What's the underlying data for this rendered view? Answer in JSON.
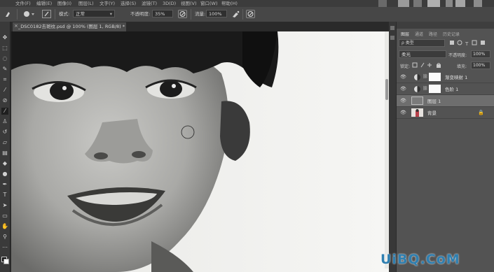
{
  "menubar": {
    "items": [
      "文件(F)",
      "编辑(E)",
      "图像(I)",
      "图层(L)",
      "文字(Y)",
      "选择(S)",
      "滤镜(T)",
      "3D(D)",
      "视图(V)",
      "窗口(W)",
      "帮助(H)"
    ]
  },
  "options": {
    "mode_label": "模式:",
    "mode_value": "正常",
    "opacity_label": "不透明度:",
    "opacity_value": "35%",
    "flow_label": "流量:",
    "flow_value": "100%"
  },
  "document": {
    "tab_title": "_DSC0182去斑纹.psd @ 100% (图层 1, RGB/8) *",
    "close_glyph": "×"
  },
  "layers_panel": {
    "tabs": [
      "图层",
      "通道",
      "路径",
      "历史记录"
    ],
    "filter_label": "ρ 类型",
    "blend_mode": "柔光",
    "opacity_label": "不透明度:",
    "opacity_value": "100%",
    "lock_label": "锁定:",
    "fill_label": "填充:",
    "fill_value": "100%",
    "layers": [
      {
        "name": "渐变映射 1",
        "type": "adjustment"
      },
      {
        "name": "色阶 1",
        "type": "adjustment"
      },
      {
        "name": "图层 1",
        "type": "pixel",
        "selected": true
      },
      {
        "name": "背景",
        "type": "background",
        "locked": true
      }
    ]
  },
  "watermark": {
    "text": "UiBQ.CoM"
  },
  "colors": {
    "accent": "#2f7fb0",
    "panel_bg": "#535353",
    "selected_layer": "#6e6e6e"
  }
}
